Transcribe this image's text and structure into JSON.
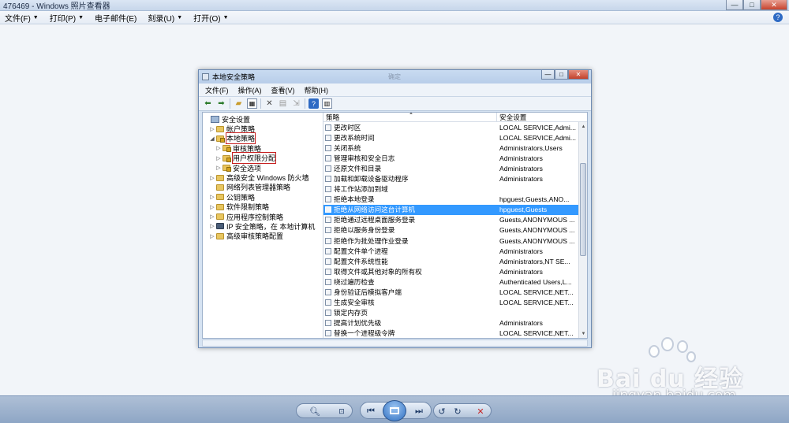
{
  "viewer": {
    "title": "476469 - Windows 照片查看器",
    "menu": [
      {
        "label": "文件(F)",
        "has_caret": true
      },
      {
        "label": "打印(P)",
        "has_caret": true
      },
      {
        "label": "电子邮件(E)",
        "has_caret": false
      },
      {
        "label": "刻录(U)",
        "has_caret": true
      },
      {
        "label": "打开(O)",
        "has_caret": true
      }
    ],
    "help_icon": "?",
    "controls": {
      "minimize": "—",
      "maximize": "□",
      "close": "✕"
    }
  },
  "inner": {
    "title": "本地安全策略",
    "ghost_text": "确定",
    "menu": [
      "文件(F)",
      "操作(A)",
      "查看(V)",
      "帮助(H)"
    ],
    "controls": {
      "minimize": "—",
      "maximize": "□",
      "close": "✕"
    },
    "tree": [
      {
        "label": "安全设置",
        "level": 0,
        "expander": "",
        "icon": "root-icon"
      },
      {
        "label": "帐户策略",
        "level": 1,
        "expander": "▷",
        "icon": "folder-icon"
      },
      {
        "label": "本地策略",
        "level": 1,
        "expander": "◢",
        "icon": "folder-lock-icon",
        "highlighted": true
      },
      {
        "label": "审核策略",
        "level": 2,
        "expander": "▷",
        "icon": "folder-lock-icon"
      },
      {
        "label": "用户权限分配",
        "level": 2,
        "expander": "▷",
        "icon": "folder-lock-icon",
        "highlighted": true
      },
      {
        "label": "安全选项",
        "level": 2,
        "expander": "▷",
        "icon": "folder-lock-icon"
      },
      {
        "label": "高级安全 Windows 防火墙",
        "level": 1,
        "expander": "▷",
        "icon": "folder-icon"
      },
      {
        "label": "网络列表管理器策略",
        "level": 1,
        "expander": "",
        "icon": "folder-icon"
      },
      {
        "label": "公钥策略",
        "level": 1,
        "expander": "▷",
        "icon": "folder-icon"
      },
      {
        "label": "软件限制策略",
        "level": 1,
        "expander": "▷",
        "icon": "folder-icon"
      },
      {
        "label": "应用程序控制策略",
        "level": 1,
        "expander": "▷",
        "icon": "folder-icon"
      },
      {
        "label": "IP 安全策略，在 本地计算机",
        "level": 1,
        "expander": "▷",
        "icon": "computer-icon"
      },
      {
        "label": "高级审核策略配置",
        "level": 1,
        "expander": "▷",
        "icon": "folder-icon"
      }
    ],
    "list": {
      "col_policy": "策略",
      "col_setting": "安全设置",
      "sort_indicator": "▲",
      "rows": [
        {
          "policy": "更改时区",
          "setting": "LOCAL SERVICE,Admi..."
        },
        {
          "policy": "更改系统时间",
          "setting": "LOCAL SERVICE,Admi..."
        },
        {
          "policy": "关闭系统",
          "setting": "Administrators,Users"
        },
        {
          "policy": "管理审核和安全日志",
          "setting": "Administrators"
        },
        {
          "policy": "还原文件和目录",
          "setting": "Administrators"
        },
        {
          "policy": "加载和卸载设备驱动程序",
          "setting": "Administrators"
        },
        {
          "policy": "将工作站添加到域",
          "setting": ""
        },
        {
          "policy": "拒绝本地登录",
          "setting": "hpguest,Guests,ANO..."
        },
        {
          "policy": "拒绝从网络访问这台计算机",
          "setting": "hpguest,Guests",
          "selected": true
        },
        {
          "policy": "拒绝通过远程桌面服务登录",
          "setting": "Guests,ANONYMOUS ..."
        },
        {
          "policy": "拒绝以服务身份登录",
          "setting": "Guests,ANONYMOUS ..."
        },
        {
          "policy": "拒绝作为批处理作业登录",
          "setting": "Guests,ANONYMOUS ..."
        },
        {
          "policy": "配置文件单个进程",
          "setting": "Administrators"
        },
        {
          "policy": "配置文件系统性能",
          "setting": "Administrators,NT SE..."
        },
        {
          "policy": "取得文件或其他对象的所有权",
          "setting": "Administrators"
        },
        {
          "policy": "绕过遍历检查",
          "setting": "Authenticated Users,L..."
        },
        {
          "policy": "身份验证后模拟客户端",
          "setting": "LOCAL SERVICE,NET..."
        },
        {
          "policy": "生成安全审核",
          "setting": "LOCAL SERVICE,NET..."
        },
        {
          "policy": "锁定内存页",
          "setting": ""
        },
        {
          "policy": "提高计划优先级",
          "setting": "Administrators"
        },
        {
          "policy": "替换一个进程级令牌",
          "setting": "LOCAL SERVICE,NET..."
        }
      ]
    }
  },
  "bottom_bar": {
    "zoom_icon": "magnifier-icon",
    "fit_icon": "fit-icon",
    "prev_icon": "previous-icon",
    "slideshow_icon": "slideshow-icon",
    "next_icon": "next-icon",
    "rotate_left_icon": "rotate-ccw-icon",
    "rotate_right_icon": "rotate-cw-icon",
    "delete_icon": "delete-icon"
  },
  "watermark": {
    "brand": "Bai du 经验",
    "url": "jingyan.baidu.com"
  }
}
